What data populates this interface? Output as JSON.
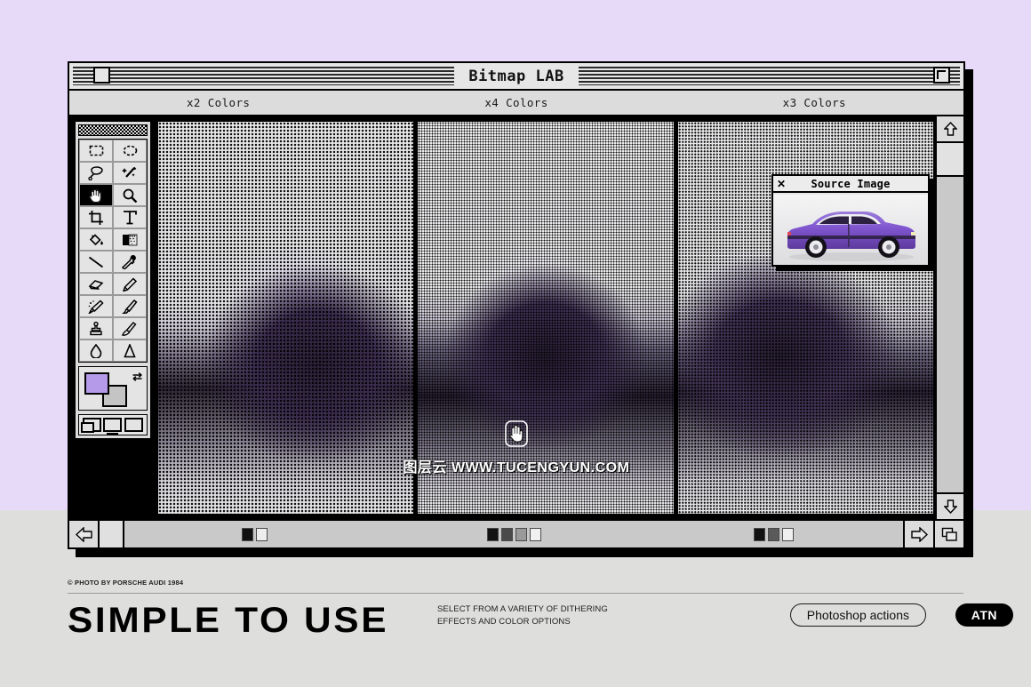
{
  "page": {
    "background_lavender": "#e7daf8",
    "background_footer": "#dededd",
    "accent_purple": "#b49ae8"
  },
  "window": {
    "title": "Bitmap LAB",
    "close_box": "close-box",
    "zoom_box": "zoom-box",
    "columns": [
      {
        "label": "x2 Colors",
        "swatch_count": 2
      },
      {
        "label": "x4 Colors",
        "swatch_count": 4
      },
      {
        "label": "x3 Colors",
        "swatch_count": 3
      }
    ]
  },
  "toolbar": {
    "tools": [
      {
        "name": "marquee-rect-tool",
        "glyph": "▭",
        "selected": false
      },
      {
        "name": "marquee-ellipse-tool",
        "glyph": "◯",
        "selected": false
      },
      {
        "name": "lasso-tool",
        "glyph": "lasso",
        "selected": false
      },
      {
        "name": "magic-wand-tool",
        "glyph": "wand",
        "selected": false
      },
      {
        "name": "hand-tool",
        "glyph": "hand",
        "selected": true
      },
      {
        "name": "zoom-tool",
        "glyph": "magnifier",
        "selected": false
      },
      {
        "name": "crop-tool",
        "glyph": "crop",
        "selected": false
      },
      {
        "name": "type-tool",
        "glyph": "T",
        "selected": false
      },
      {
        "name": "paint-bucket-tool",
        "glyph": "bucket",
        "selected": false
      },
      {
        "name": "gradient-tool",
        "glyph": "gradient",
        "selected": false
      },
      {
        "name": "line-tool",
        "glyph": "line",
        "selected": false
      },
      {
        "name": "eyedropper-tool",
        "glyph": "dropper",
        "selected": false
      },
      {
        "name": "eraser-tool",
        "glyph": "eraser",
        "selected": false
      },
      {
        "name": "pencil-tool",
        "glyph": "pencil",
        "selected": false
      },
      {
        "name": "airbrush-tool",
        "glyph": "airbrush",
        "selected": false
      },
      {
        "name": "paintbrush-tool",
        "glyph": "brush",
        "selected": false
      },
      {
        "name": "stamp-tool",
        "glyph": "stamp",
        "selected": false
      },
      {
        "name": "smudge-tool",
        "glyph": "smudge",
        "selected": false
      },
      {
        "name": "blur-tool",
        "glyph": "droplet",
        "selected": false
      },
      {
        "name": "dodge-tool",
        "glyph": "dodge",
        "selected": false
      }
    ],
    "foreground_color": "#b49ae8",
    "background_color": "#c4c4c4",
    "swap_colors": "swap-colors-icon",
    "screen_modes": [
      "standard-screen-mode",
      "full-screen-menubar-mode",
      "full-screen-mode"
    ]
  },
  "source_window": {
    "title": "Source Image",
    "close_label": "✕"
  },
  "watermark": {
    "text": "图层云 WWW.TUCENGYUN.COM"
  },
  "statusbar": {
    "prev_label": "⇦",
    "next_label": "⇨",
    "copy_label": "copy-window-icon",
    "segments": [
      {
        "colors": [
          "#111111",
          "#eeeeee"
        ]
      },
      {
        "colors": [
          "#111111",
          "#4a4a4a",
          "#9a9a9a",
          "#f0f0f0"
        ]
      },
      {
        "colors": [
          "#111111",
          "#5a5a5a",
          "#f0f0f0"
        ]
      }
    ]
  },
  "scrollbar": {
    "up_label": "⇧",
    "down_label": "⇩"
  },
  "footer": {
    "credit": "© PHOTO BY PORSCHE AUDI 1984",
    "headline": "SIMPLE TO USE",
    "subcopy": "SELECT FROM A VARIETY OF DITHERING EFFECTS AND COLOR OPTIONS",
    "pill_photoshop": "Photoshop actions",
    "pill_atn": "ATN"
  }
}
